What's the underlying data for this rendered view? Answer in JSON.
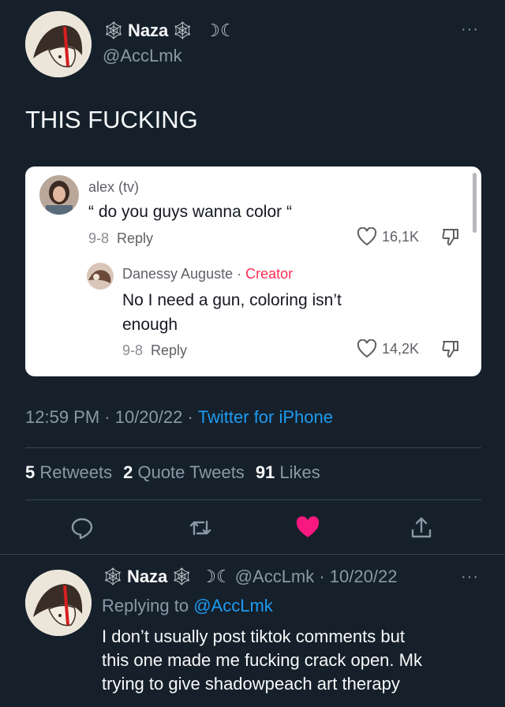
{
  "tweet": {
    "display_name": "Naza",
    "name_deco_left": "🕸",
    "name_deco_right": "🕸",
    "name_deco_moon": "☽☾",
    "handle": "@AccLmk",
    "more": "···",
    "text": "THIS FUCKING",
    "timestamp": "12:59 PM · 10/20/22 ·",
    "source": "Twitter for iPhone",
    "stats": {
      "retweets_count": "5",
      "retweets_label": "Retweets",
      "quotes_count": "2",
      "quotes_label": "Quote Tweets",
      "likes_count": "91",
      "likes_label": "Likes"
    }
  },
  "tiktok": {
    "comment1": {
      "user": "alex (tv)",
      "text": "“ do you guys wanna color “",
      "date": "9-8",
      "reply": "Reply",
      "likes": "16,1K"
    },
    "comment2": {
      "user": "Danessy Auguste ·",
      "creator": "Creator",
      "text_line1": "No I need a gun, coloring isn’t",
      "text_line2": "enough",
      "date": "9-8",
      "reply": "Reply",
      "likes": "14,2K"
    }
  },
  "reply_tweet": {
    "display_name": "Naza",
    "meta": "@AccLmk · 10/20/22",
    "replying_prefix": "Replying to",
    "replying_to": "@AccLmk",
    "more": "···",
    "line1": "I don’t usually post tiktok comments but",
    "line2": "this one made me fucking crack open. Mk",
    "line3": "trying to give shadowpeach art therapy"
  },
  "colors": {
    "background": "#15202b",
    "accent": "#1d9bf0",
    "like": "#f91880",
    "creator": "#fe2c55"
  }
}
